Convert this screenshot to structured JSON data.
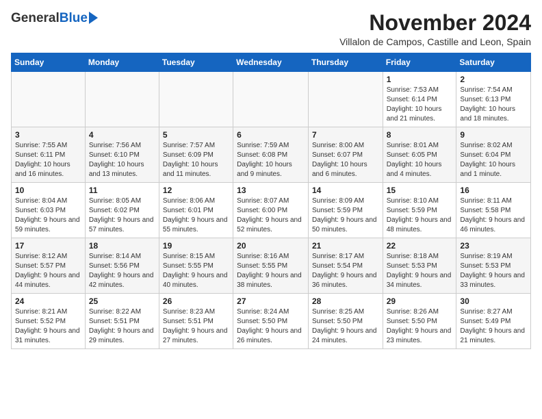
{
  "header": {
    "logo_general": "General",
    "logo_blue": "Blue",
    "month_title": "November 2024",
    "subtitle": "Villalon de Campos, Castille and Leon, Spain"
  },
  "weekdays": [
    "Sunday",
    "Monday",
    "Tuesday",
    "Wednesday",
    "Thursday",
    "Friday",
    "Saturday"
  ],
  "weeks": [
    [
      {
        "day": "",
        "info": ""
      },
      {
        "day": "",
        "info": ""
      },
      {
        "day": "",
        "info": ""
      },
      {
        "day": "",
        "info": ""
      },
      {
        "day": "",
        "info": ""
      },
      {
        "day": "1",
        "info": "Sunrise: 7:53 AM\nSunset: 6:14 PM\nDaylight: 10 hours and 21 minutes."
      },
      {
        "day": "2",
        "info": "Sunrise: 7:54 AM\nSunset: 6:13 PM\nDaylight: 10 hours and 18 minutes."
      }
    ],
    [
      {
        "day": "3",
        "info": "Sunrise: 7:55 AM\nSunset: 6:11 PM\nDaylight: 10 hours and 16 minutes."
      },
      {
        "day": "4",
        "info": "Sunrise: 7:56 AM\nSunset: 6:10 PM\nDaylight: 10 hours and 13 minutes."
      },
      {
        "day": "5",
        "info": "Sunrise: 7:57 AM\nSunset: 6:09 PM\nDaylight: 10 hours and 11 minutes."
      },
      {
        "day": "6",
        "info": "Sunrise: 7:59 AM\nSunset: 6:08 PM\nDaylight: 10 hours and 9 minutes."
      },
      {
        "day": "7",
        "info": "Sunrise: 8:00 AM\nSunset: 6:07 PM\nDaylight: 10 hours and 6 minutes."
      },
      {
        "day": "8",
        "info": "Sunrise: 8:01 AM\nSunset: 6:05 PM\nDaylight: 10 hours and 4 minutes."
      },
      {
        "day": "9",
        "info": "Sunrise: 8:02 AM\nSunset: 6:04 PM\nDaylight: 10 hours and 1 minute."
      }
    ],
    [
      {
        "day": "10",
        "info": "Sunrise: 8:04 AM\nSunset: 6:03 PM\nDaylight: 9 hours and 59 minutes."
      },
      {
        "day": "11",
        "info": "Sunrise: 8:05 AM\nSunset: 6:02 PM\nDaylight: 9 hours and 57 minutes."
      },
      {
        "day": "12",
        "info": "Sunrise: 8:06 AM\nSunset: 6:01 PM\nDaylight: 9 hours and 55 minutes."
      },
      {
        "day": "13",
        "info": "Sunrise: 8:07 AM\nSunset: 6:00 PM\nDaylight: 9 hours and 52 minutes."
      },
      {
        "day": "14",
        "info": "Sunrise: 8:09 AM\nSunset: 5:59 PM\nDaylight: 9 hours and 50 minutes."
      },
      {
        "day": "15",
        "info": "Sunrise: 8:10 AM\nSunset: 5:59 PM\nDaylight: 9 hours and 48 minutes."
      },
      {
        "day": "16",
        "info": "Sunrise: 8:11 AM\nSunset: 5:58 PM\nDaylight: 9 hours and 46 minutes."
      }
    ],
    [
      {
        "day": "17",
        "info": "Sunrise: 8:12 AM\nSunset: 5:57 PM\nDaylight: 9 hours and 44 minutes."
      },
      {
        "day": "18",
        "info": "Sunrise: 8:14 AM\nSunset: 5:56 PM\nDaylight: 9 hours and 42 minutes."
      },
      {
        "day": "19",
        "info": "Sunrise: 8:15 AM\nSunset: 5:55 PM\nDaylight: 9 hours and 40 minutes."
      },
      {
        "day": "20",
        "info": "Sunrise: 8:16 AM\nSunset: 5:55 PM\nDaylight: 9 hours and 38 minutes."
      },
      {
        "day": "21",
        "info": "Sunrise: 8:17 AM\nSunset: 5:54 PM\nDaylight: 9 hours and 36 minutes."
      },
      {
        "day": "22",
        "info": "Sunrise: 8:18 AM\nSunset: 5:53 PM\nDaylight: 9 hours and 34 minutes."
      },
      {
        "day": "23",
        "info": "Sunrise: 8:19 AM\nSunset: 5:53 PM\nDaylight: 9 hours and 33 minutes."
      }
    ],
    [
      {
        "day": "24",
        "info": "Sunrise: 8:21 AM\nSunset: 5:52 PM\nDaylight: 9 hours and 31 minutes."
      },
      {
        "day": "25",
        "info": "Sunrise: 8:22 AM\nSunset: 5:51 PM\nDaylight: 9 hours and 29 minutes."
      },
      {
        "day": "26",
        "info": "Sunrise: 8:23 AM\nSunset: 5:51 PM\nDaylight: 9 hours and 27 minutes."
      },
      {
        "day": "27",
        "info": "Sunrise: 8:24 AM\nSunset: 5:50 PM\nDaylight: 9 hours and 26 minutes."
      },
      {
        "day": "28",
        "info": "Sunrise: 8:25 AM\nSunset: 5:50 PM\nDaylight: 9 hours and 24 minutes."
      },
      {
        "day": "29",
        "info": "Sunrise: 8:26 AM\nSunset: 5:50 PM\nDaylight: 9 hours and 23 minutes."
      },
      {
        "day": "30",
        "info": "Sunrise: 8:27 AM\nSunset: 5:49 PM\nDaylight: 9 hours and 21 minutes."
      }
    ]
  ]
}
